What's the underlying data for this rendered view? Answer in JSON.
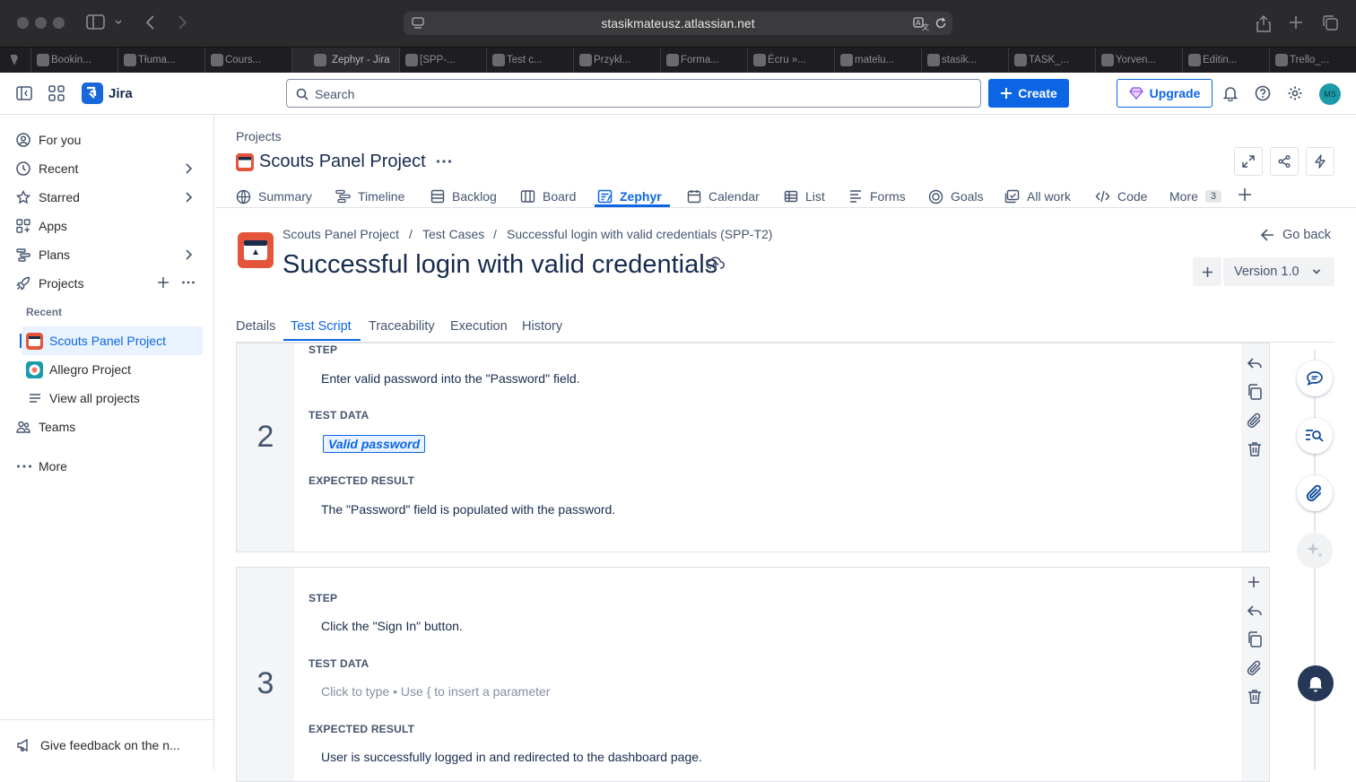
{
  "browser": {
    "url": "stasikmateusz.atlassian.net",
    "tabs": [
      "Bookin...",
      "Tłuma...",
      "Cours...",
      "Zephyr - Jira",
      "[SPP-...",
      "Test c...",
      "Przykł...",
      "Forma...",
      "Écru »...",
      "matelu...",
      "stasik...",
      "TASK_...",
      "Yorven...",
      "Editin...",
      "Trello_..."
    ]
  },
  "header": {
    "app_name": "Jira",
    "search_placeholder": "Search",
    "create_label": "Create",
    "upgrade_label": "Upgrade",
    "avatar_initials": "MS"
  },
  "sidebar": {
    "for_you": "For you",
    "recent": "Recent",
    "starred": "Starred",
    "apps": "Apps",
    "plans": "Plans",
    "projects": "Projects",
    "recent_heading": "Recent",
    "project_items": [
      "Scouts Panel Project",
      "Allegro Project",
      "View all projects"
    ],
    "teams": "Teams",
    "more": "More",
    "feedback": "Give feedback on the n..."
  },
  "project": {
    "breadcrumb_root": "Projects",
    "name": "Scouts Panel Project",
    "tabs": [
      "Summary",
      "Timeline",
      "Backlog",
      "Board",
      "Zephyr",
      "Calendar",
      "List",
      "Forms",
      "Goals",
      "All work",
      "Code",
      "More"
    ],
    "active_tab": "Zephyr",
    "more_count": "3"
  },
  "testcase": {
    "breadcrumb": [
      "Scouts Panel Project",
      "Test Cases",
      "Successful login with valid credentials (SPP-T2)"
    ],
    "title": "Successful login with valid credentials",
    "go_back": "Go back",
    "version": "Version 1.0",
    "tabs": [
      "Details",
      "Test Script",
      "Traceability",
      "Execution",
      "History"
    ],
    "active_tab": "Test Script"
  },
  "steps": [
    {
      "number": "2",
      "step_label": "STEP",
      "step": "Enter valid password into the \"Password\" field.",
      "data_label": "TEST DATA",
      "data_param": "Valid password",
      "result_label": "EXPECTED RESULT",
      "result": "The \"Password\" field is populated with the password."
    },
    {
      "number": "3",
      "step_label": "STEP",
      "step": "Click the \"Sign In\" button.",
      "data_label": "TEST DATA",
      "data_placeholder": "Click to type • Use { to insert a parameter",
      "result_label": "EXPECTED RESULT",
      "result": "User is successfully logged in and redirected to the dashboard page."
    }
  ],
  "colors": {
    "brand_blue": "#0c66e4",
    "zephyr_orange": "#e4553b",
    "chrome_dark": "#2b2b2d"
  }
}
